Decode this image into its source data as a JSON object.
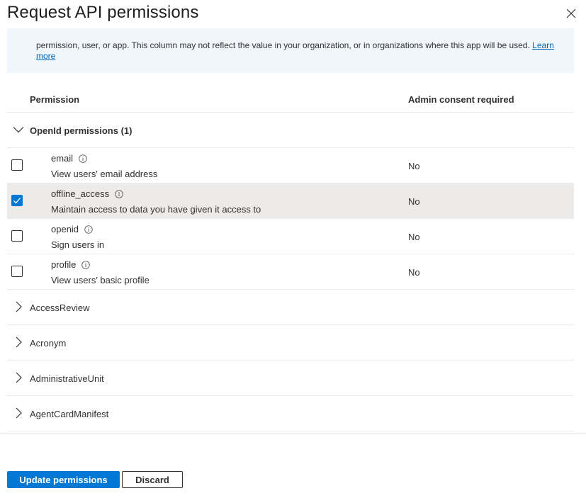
{
  "panel": {
    "title": "Request API permissions",
    "close_icon": "close-icon"
  },
  "banner": {
    "text": "permission, user, or app. This column may not reflect the value in your organization, or in organizations where this app will be used. ",
    "link_label": "Learn more"
  },
  "table": {
    "headers": {
      "permission": "Permission",
      "admin_consent": "Admin consent required"
    },
    "expanded_group": {
      "label": "OpenId permissions (1)",
      "icon": "chevron-down-icon"
    },
    "permissions": [
      {
        "name": "email",
        "description": "View users' email address",
        "admin_consent": "No",
        "checked": false
      },
      {
        "name": "offline_access",
        "description": "Maintain access to data you have given it access to",
        "admin_consent": "No",
        "checked": true
      },
      {
        "name": "openid",
        "description": "Sign users in",
        "admin_consent": "No",
        "checked": false
      },
      {
        "name": "profile",
        "description": "View users' basic profile",
        "admin_consent": "No",
        "checked": false
      }
    ],
    "collapsed_groups": [
      {
        "label": "AccessReview",
        "icon": "chevron-right-icon"
      },
      {
        "label": "Acronym",
        "icon": "chevron-right-icon"
      },
      {
        "label": "AdministrativeUnit",
        "icon": "chevron-right-icon"
      },
      {
        "label": "AgentCardManifest",
        "icon": "chevron-right-icon"
      }
    ]
  },
  "footer": {
    "primary_label": "Update permissions",
    "secondary_label": "Discard"
  },
  "colors": {
    "accent": "#0078d4",
    "banner_bg": "#eff6fc",
    "selected_row_bg": "#edebe9",
    "link": "#0067b8"
  }
}
